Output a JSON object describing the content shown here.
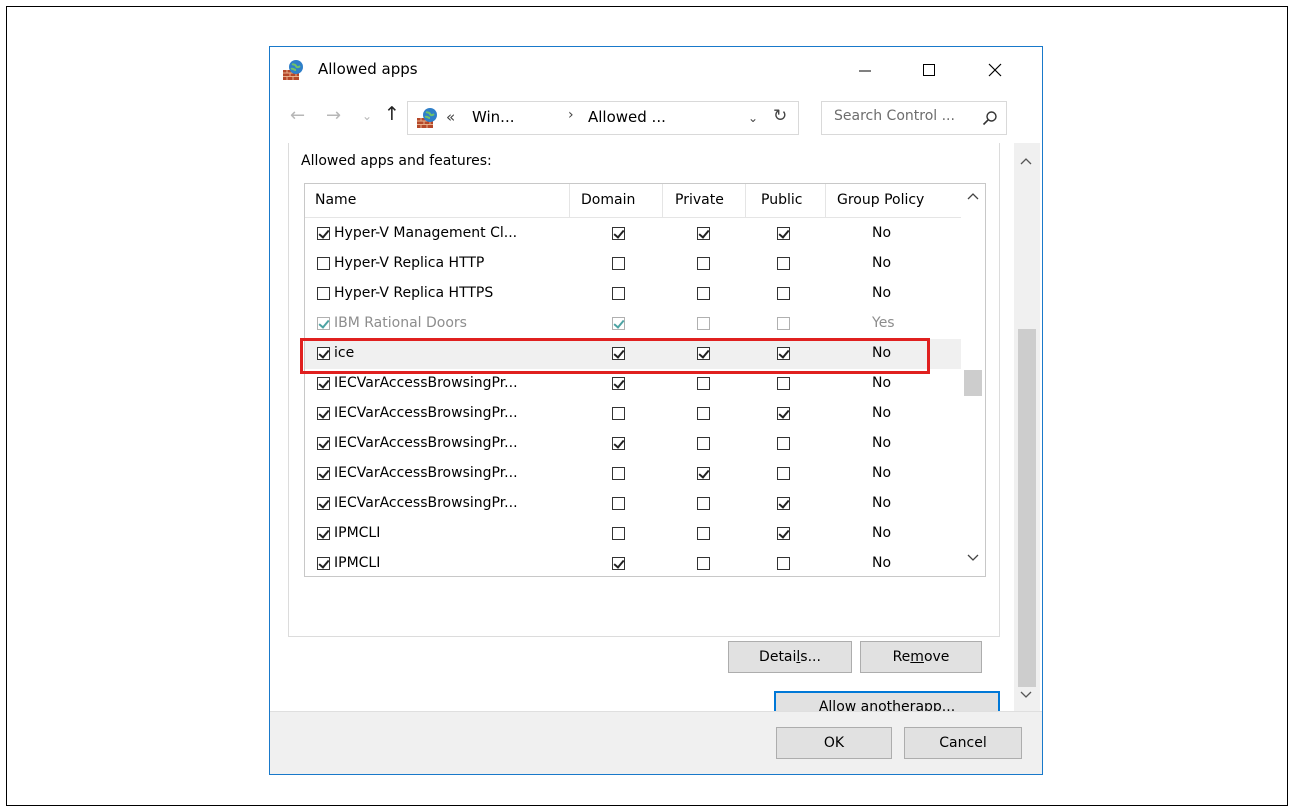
{
  "window": {
    "title": "Allowed apps",
    "minimize_symbol": "—",
    "maximize_symbol": "☐",
    "close_symbol": "✕"
  },
  "nav": {
    "back_symbol": "←",
    "forward_symbol": "→",
    "recent_symbol": "⌄",
    "up_symbol": "↑",
    "address_chevrons": "«",
    "address_segments": [
      "Win...",
      "Allowed ..."
    ],
    "address_separator": "›",
    "dropdown_symbol": "⌄",
    "refresh_symbol": "↻",
    "search_placeholder": "Search Control ..."
  },
  "panel": {
    "group_label": "Allowed apps and features:"
  },
  "table": {
    "columns": [
      "Name",
      "Domain",
      "Private",
      "Public",
      "Group Policy"
    ],
    "rows": [
      {
        "name": "Hyper-V Management Cl...",
        "enabled": true,
        "domain": true,
        "private": true,
        "public": true,
        "group_policy": "No",
        "disabled": false,
        "selected": false
      },
      {
        "name": "Hyper-V Replica HTTP",
        "enabled": false,
        "domain": false,
        "private": false,
        "public": false,
        "group_policy": "No",
        "disabled": false,
        "selected": false
      },
      {
        "name": "Hyper-V Replica HTTPS",
        "enabled": false,
        "domain": false,
        "private": false,
        "public": false,
        "group_policy": "No",
        "disabled": false,
        "selected": false
      },
      {
        "name": "IBM Rational Doors",
        "enabled": true,
        "domain": true,
        "private": false,
        "public": false,
        "group_policy": "Yes",
        "disabled": true,
        "selected": false
      },
      {
        "name": "ice",
        "enabled": true,
        "domain": true,
        "private": true,
        "public": true,
        "group_policy": "No",
        "disabled": false,
        "selected": true
      },
      {
        "name": "IECVarAccessBrowsingPr...",
        "enabled": true,
        "domain": true,
        "private": false,
        "public": false,
        "group_policy": "No",
        "disabled": false,
        "selected": false
      },
      {
        "name": "IECVarAccessBrowsingPr...",
        "enabled": true,
        "domain": false,
        "private": false,
        "public": true,
        "group_policy": "No",
        "disabled": false,
        "selected": false
      },
      {
        "name": "IECVarAccessBrowsingPr...",
        "enabled": true,
        "domain": true,
        "private": false,
        "public": false,
        "group_policy": "No",
        "disabled": false,
        "selected": false
      },
      {
        "name": "IECVarAccessBrowsingPr...",
        "enabled": true,
        "domain": false,
        "private": true,
        "public": false,
        "group_policy": "No",
        "disabled": false,
        "selected": false
      },
      {
        "name": "IECVarAccessBrowsingPr...",
        "enabled": true,
        "domain": false,
        "private": false,
        "public": true,
        "group_policy": "No",
        "disabled": false,
        "selected": false
      },
      {
        "name": "IPMCLI",
        "enabled": true,
        "domain": false,
        "private": false,
        "public": true,
        "group_policy": "No",
        "disabled": false,
        "selected": false
      },
      {
        "name": "IPMCLI",
        "enabled": true,
        "domain": true,
        "private": false,
        "public": false,
        "group_policy": "No",
        "disabled": false,
        "selected": false
      }
    ]
  },
  "buttons": {
    "details_pre": "Detai",
    "details_key": "l",
    "details_post": "s...",
    "remove_pre": "Re",
    "remove_key": "m",
    "remove_post": "ove",
    "allow_pre": "Allow anothe",
    "allow_key": "r",
    "allow_post": " app...",
    "ok": "OK",
    "cancel": "Cancel"
  },
  "scroll_symbols": {
    "up": "▲",
    "down": "▼",
    "up_thin": "^",
    "down_thin": "v"
  },
  "colors": {
    "window_border": "#1979ca",
    "highlight": "#e0201f",
    "default_button_border": "#0078d7"
  }
}
